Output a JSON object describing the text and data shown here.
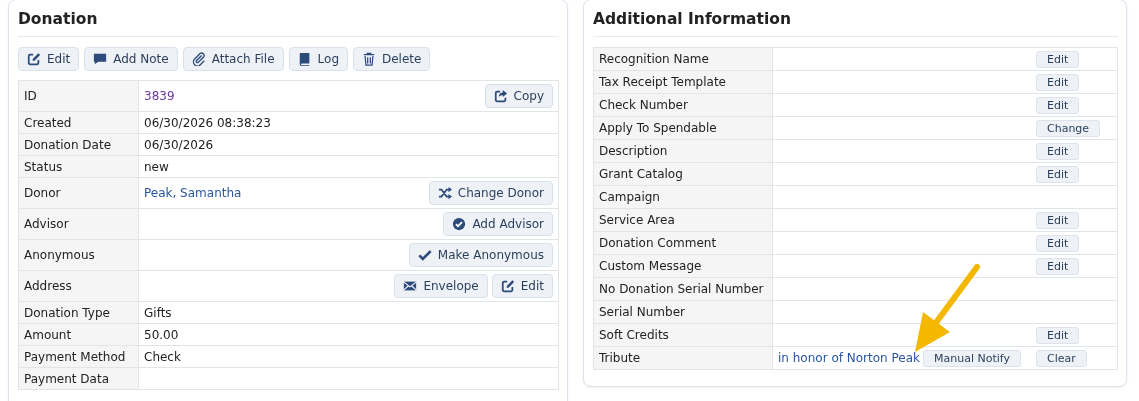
{
  "donation": {
    "title": "Donation",
    "toolbar": [
      {
        "label": "Edit",
        "kind": "edit"
      },
      {
        "label": "Add Note",
        "kind": "comment"
      },
      {
        "label": "Attach File",
        "kind": "paperclip"
      },
      {
        "label": "Log",
        "kind": "book"
      },
      {
        "label": "Delete",
        "kind": "trash"
      }
    ],
    "rows": [
      {
        "label": "ID",
        "value": "3839",
        "kind": "visited",
        "actions": [
          {
            "label": "Copy",
            "kind": "share"
          }
        ]
      },
      {
        "label": "Created",
        "value": "06/30/2026 08:38:23",
        "kind": "text"
      },
      {
        "label": "Donation Date",
        "value": "06/30/2026",
        "kind": "text"
      },
      {
        "label": "Status",
        "value": "new",
        "kind": "text"
      },
      {
        "label": "Donor",
        "value": "Peak, Samantha",
        "kind": "link",
        "actions": [
          {
            "label": "Change Donor",
            "kind": "shuffle"
          }
        ]
      },
      {
        "label": "Advisor",
        "actions": [
          {
            "label": "Add Advisor",
            "kind": "check-circle"
          }
        ]
      },
      {
        "label": "Anonymous",
        "actions": [
          {
            "label": "Make Anonymous",
            "kind": "check"
          }
        ]
      },
      {
        "label": "Address",
        "actions": [
          {
            "label": "Envelope",
            "kind": "envelope"
          },
          {
            "label": "Edit",
            "kind": "edit"
          }
        ]
      },
      {
        "label": "Donation Type",
        "value": "Gifts",
        "kind": "text"
      },
      {
        "label": "Amount",
        "value": "50.00",
        "kind": "text"
      },
      {
        "label": "Payment Method",
        "value": "Check",
        "kind": "text"
      },
      {
        "label": "Payment Data"
      }
    ]
  },
  "additional": {
    "title": "Additional Information",
    "rows": [
      {
        "label": "Recognition Name",
        "action": "Edit"
      },
      {
        "label": "Tax Receipt Template",
        "action": "Edit"
      },
      {
        "label": "Check Number",
        "action": "Edit"
      },
      {
        "label": "Apply To Spendable",
        "action": "Change"
      },
      {
        "label": "Description",
        "action": "Edit"
      },
      {
        "label": "Grant Catalog",
        "action": "Edit"
      },
      {
        "label": "Campaign"
      },
      {
        "label": "Service Area",
        "action": "Edit"
      },
      {
        "label": "Donation Comment",
        "action": "Edit"
      },
      {
        "label": "Custom Message",
        "action": "Edit"
      },
      {
        "label": "No Donation Serial Number"
      },
      {
        "label": "Serial Number"
      },
      {
        "label": "Soft Credits",
        "action": "Edit"
      },
      {
        "label": "Tribute",
        "value": "in honor of Norton Peak",
        "inline_action": "Manual Notify",
        "action": "Clear"
      }
    ]
  },
  "annotations": [
    {
      "kind": "arrow"
    }
  ]
}
